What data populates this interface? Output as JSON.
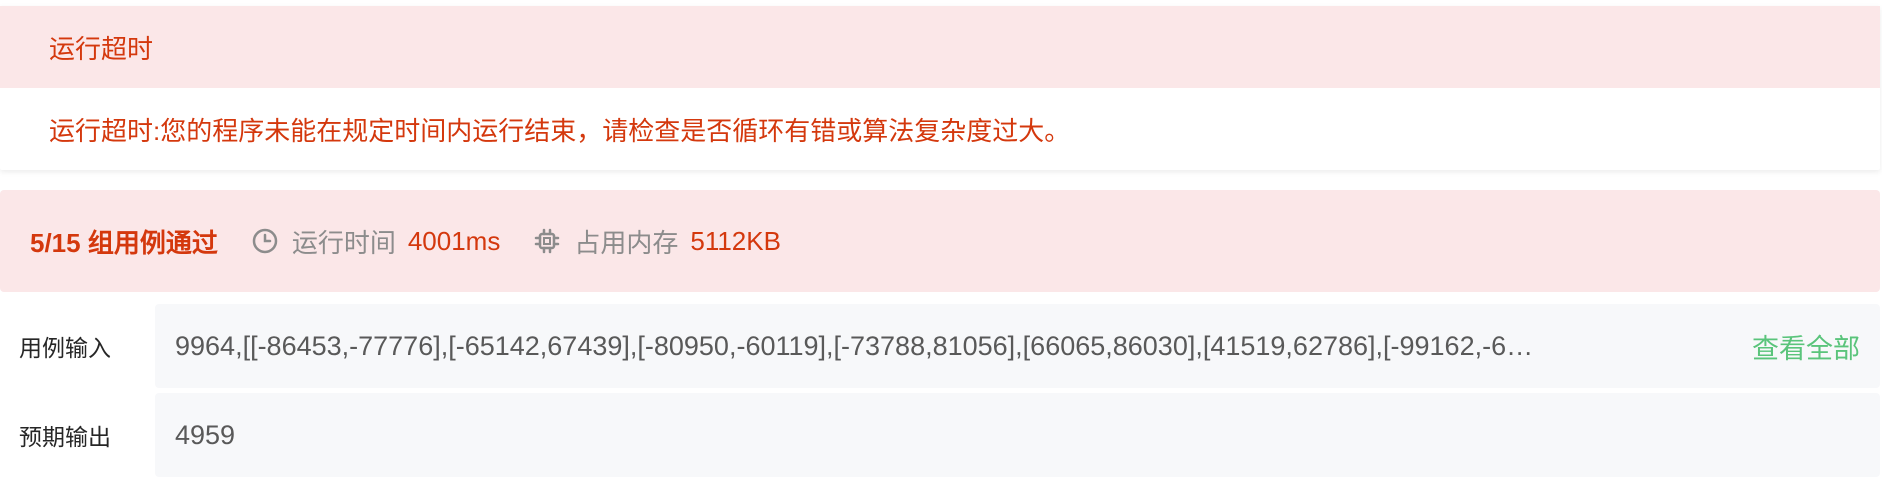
{
  "error": {
    "title": "运行超时",
    "message": "运行超时:您的程序未能在规定时间内运行结束，请检查是否循环有错或算法复杂度过大。"
  },
  "summary": {
    "pass_count": "5/15 组用例通过",
    "runtime_label": "运行时间",
    "runtime_value": "4001ms",
    "memory_label": "占用内存",
    "memory_value": "5112KB"
  },
  "input": {
    "label": "用例输入",
    "value": "9964,[[-86453,-77776],[-65142,67439],[-80950,-60119],[-73788,81056],[66065,86030],[41519,62786],[-99162,-6…",
    "view_all": "查看全部"
  },
  "output": {
    "label": "预期输出",
    "value": "4959"
  },
  "colors": {
    "error_red": "#d4380d",
    "error_bg": "#fbe7e8",
    "link_green": "#5ac47b",
    "muted_gray": "#8c8c8c"
  },
  "icons": {
    "runtime": "clock-icon",
    "memory": "chip-icon"
  }
}
